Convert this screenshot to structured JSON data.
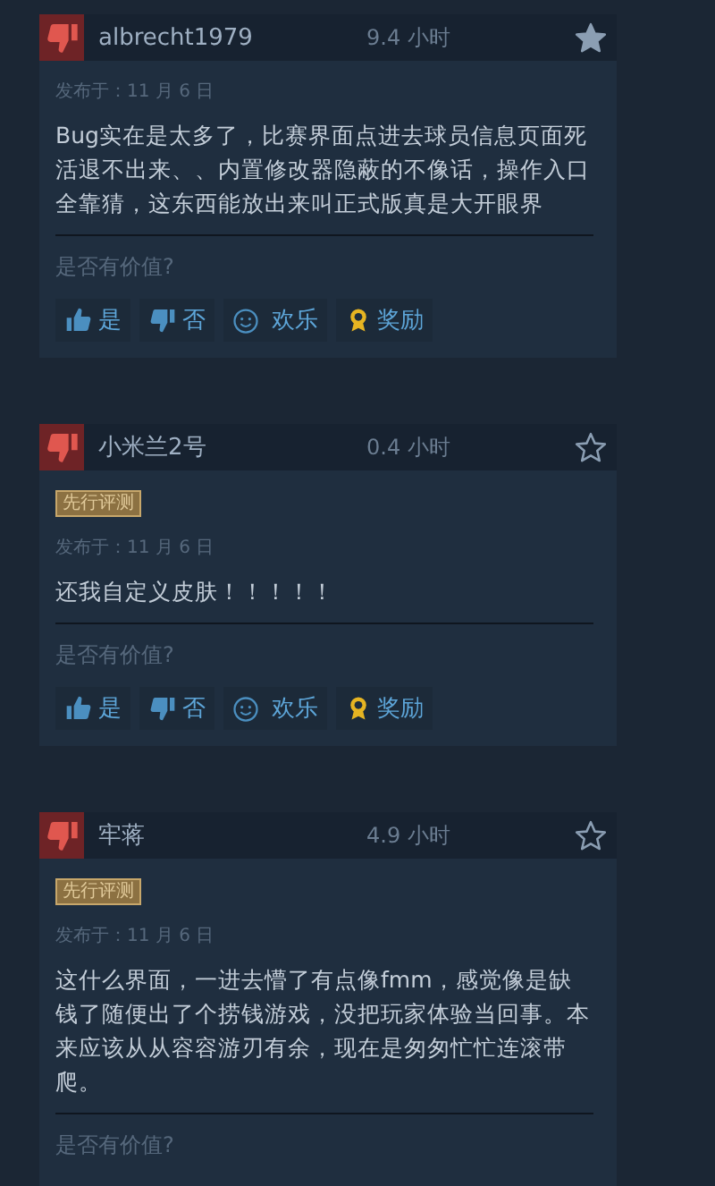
{
  "reviews": [
    {
      "recommended": false,
      "username": "albrecht1979",
      "hours": "9.4 小时",
      "favorited": true,
      "date": "发布于：11 月 6 日",
      "text": "Bug实在是太多了，比赛界面点进去球员信息页面死活退不出来、、内置修改器隐蔽的不像话，操作入口全靠猜，这东西能放出来叫正式版真是大开眼界",
      "helpful_prompt": "是否有价值?",
      "actions": [
        {
          "kind": "yes",
          "label": "是"
        },
        {
          "kind": "no",
          "label": "否"
        },
        {
          "kind": "funny",
          "label": "欢乐"
        },
        {
          "kind": "award",
          "label": "奖励"
        }
      ]
    },
    {
      "recommended": false,
      "username": "小米兰2号",
      "hours": "0.4 小时",
      "favorited": false,
      "badge": "先行评测",
      "date": "发布于：11 月 6 日",
      "text": "还我自定义皮肤！！！！！",
      "helpful_prompt": "是否有价值?",
      "actions": [
        {
          "kind": "yes",
          "label": "是"
        },
        {
          "kind": "no",
          "label": "否"
        },
        {
          "kind": "funny",
          "label": "欢乐"
        },
        {
          "kind": "award",
          "label": "奖励"
        }
      ]
    },
    {
      "recommended": false,
      "username": "牢蒋",
      "hours": "4.9 小时",
      "favorited": false,
      "badge": "先行评测",
      "date": "发布于：11 月 6 日",
      "text": "这什么界面，一进去懵了有点像fmm，感觉像是缺钱了随便出了个捞钱游戏，没把玩家体验当回事。本来应该从从容容游刃有余，现在是匆匆忙忙连滚带爬。",
      "helpful_prompt": "是否有价值?"
    }
  ]
}
